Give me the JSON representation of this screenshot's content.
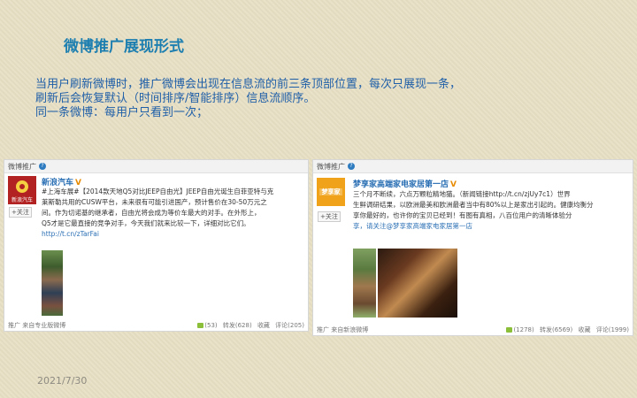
{
  "slide": {
    "title": "微博推广展现形式",
    "lines": [
      "当用户刷新微博时，推广微博会出现在信息流的前三条顶部位置，每次只展现一条，",
      "刷新后会恢复默认（时间排序/智能排序）信息流顺序。",
      "同一条微博：每用户只看到一次；"
    ],
    "date": "2021/7/30"
  },
  "cards": [
    {
      "header": "微博推广",
      "avatar_text": "新浪汽车",
      "follow": "+关注",
      "user": "新浪汽车",
      "text_lines": [
        "#上海车展#【2014款天地Q5对比JEEP自由光】JEEP自由光诞生自菲亚特与克",
        "莱斯勒共用的CUSW平台，未来很有可能引进国产，预计售价在30-50万元之",
        "间。作为切诺基的继承者，自由光将会成为等价车最大的对手。在外形上，",
        "Q5才是它最直接的竞争对手，今天我们就来比较一下，详细对比它们。"
      ],
      "link": "http://t.cn/zTarFai",
      "footer_left": "推广  来自专业版微博",
      "likes": "(53)",
      "repost": "转发(628)",
      "fav": "收藏",
      "comment": "评论(205)"
    },
    {
      "header": "微博推广",
      "avatar_text": "梦享家",
      "follow": "+关注",
      "user": "梦享家高端家电家居第一店",
      "text_lines": [
        "三个月不断续，六点万颗粒精地猫。（新闻链接http://t.cn/zjUy7c1）世界",
        "生鲜调研结果，以欧洲最美和欧洲最者当中有80%以上是家出引起的。健康均衡分",
        "享你最好的，也许你的宝贝已经到！有图有真相，八百位用户的清晰体验分",
        "享，请关注@梦享家高端家电家居第一店"
      ],
      "footer_left": "推广  来自新浪微博",
      "likes": "(1278)",
      "repost": "转发(6569)",
      "fav": "收藏",
      "comment": "评论(1999)"
    }
  ]
}
